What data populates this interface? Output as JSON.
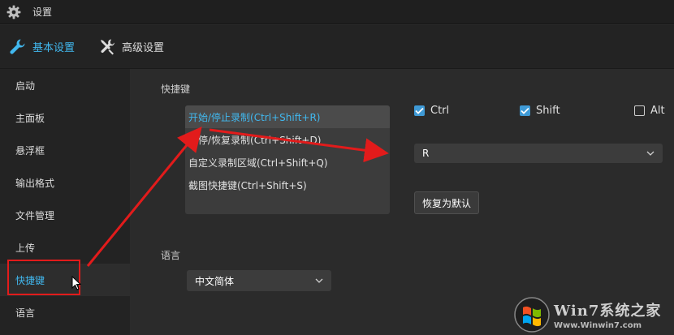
{
  "window": {
    "title": "设置"
  },
  "tabs": [
    {
      "label": "基本设置",
      "icon": "wrench-icon",
      "active": true
    },
    {
      "label": "高级设置",
      "icon": "tools-icon",
      "active": false
    }
  ],
  "sidebar": {
    "items": [
      {
        "label": "启动"
      },
      {
        "label": "主面板"
      },
      {
        "label": "悬浮框"
      },
      {
        "label": "输出格式"
      },
      {
        "label": "文件管理"
      },
      {
        "label": "上传"
      },
      {
        "label": "快捷键",
        "active": true
      },
      {
        "label": "语言"
      }
    ]
  },
  "hotkeys": {
    "section_label": "快捷键",
    "items": [
      {
        "label": "开始/停止录制(Ctrl+Shift+R)",
        "selected": true
      },
      {
        "label": "暂停/恢复录制(Ctrl+Shift+D)"
      },
      {
        "label": "自定义录制区域(Ctrl+Shift+Q)"
      },
      {
        "label": "截图快捷键(Ctrl+Shift+S)"
      }
    ],
    "modifiers": [
      {
        "label": "Ctrl",
        "checked": true
      },
      {
        "label": "Shift",
        "checked": true
      },
      {
        "label": "Alt",
        "checked": false
      }
    ],
    "key_value": "R",
    "reset_label": "恢复为默认"
  },
  "language": {
    "section_label": "语言",
    "value": "中文简体"
  },
  "watermark": {
    "brand": "Win7系统之家",
    "url": "Www.Winwin7.com"
  },
  "colors": {
    "accent": "#41b8ef",
    "annotation": "#e21b1b",
    "checkbox": "#3f9ad6"
  }
}
